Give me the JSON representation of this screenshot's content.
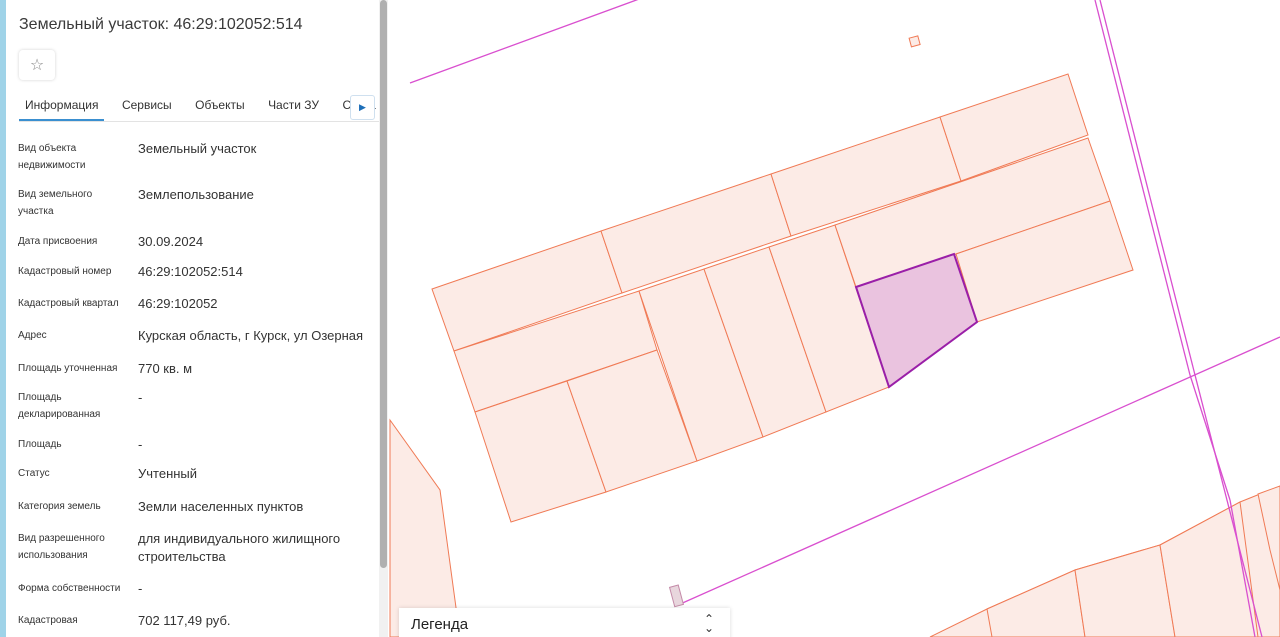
{
  "panel": {
    "title": "Земельный участок: 46:29:102052:514",
    "favorite_icon": "star-icon",
    "tabs": [
      {
        "label": "Информация",
        "active": true
      },
      {
        "label": "Сервисы"
      },
      {
        "label": "Объекты"
      },
      {
        "label": "Части ЗУ"
      },
      {
        "label": "Соста"
      }
    ],
    "tab_scroll_icon": "triangle-right-icon",
    "fields": [
      {
        "label": "Вид объекта недвижимости",
        "value": "Земельный участок"
      },
      {
        "label": "Вид земельного участка",
        "value": "Землепользование"
      },
      {
        "label": "Дата присвоения",
        "value": "30.09.2024"
      },
      {
        "label": "Кадастровый номер",
        "value": "46:29:102052:514"
      },
      {
        "label": "Кадастровый квартал",
        "value": "46:29:102052"
      },
      {
        "label": "Адрес",
        "value": "Курская область, г Курск, ул Озерная"
      },
      {
        "label": "Площадь уточненная",
        "value": "770 кв. м"
      },
      {
        "label": "Площадь декларированная",
        "value": "-"
      },
      {
        "label": "Площадь",
        "value": "-"
      },
      {
        "label": "Статус",
        "value": "Учтенный"
      },
      {
        "label": "Категория земель",
        "value": "Земли населенных пунктов"
      },
      {
        "label": "Вид разрешенного использования",
        "value": "для индивидуального жилищного строительства"
      },
      {
        "label": "Форма собственности",
        "value": "-"
      },
      {
        "label": "Кадастровая",
        "value": "702 117,49 руб."
      }
    ]
  },
  "legend": {
    "label": "Легенда",
    "toggle_icon": "chevron-up-down-icon"
  },
  "map": {
    "parcel_fill": "#fcebe6",
    "parcel_stroke": "#f07a55",
    "selected_fill": "#eac3df",
    "selected_stroke": "#9a1fa8",
    "boundary_stroke": "#d94fcf"
  }
}
